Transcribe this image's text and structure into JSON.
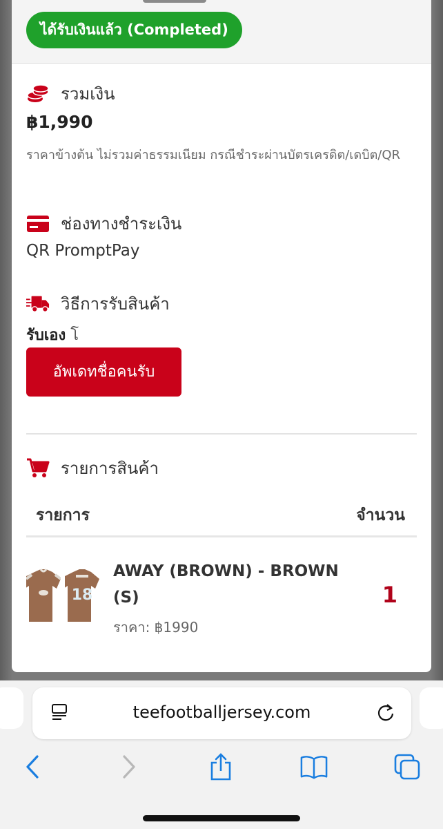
{
  "status": {
    "label": "ได้รับเงินแล้ว (Completed)",
    "color": "#1fa12b"
  },
  "total": {
    "title": "รวมเงิน",
    "icon": "coins-icon",
    "amount": "฿1,990",
    "note": "ราคาข้างต้น ไม่รวมค่าธรรมเนียม กรณีชำระผ่านบัตรเครดิต/เดบิต/QR"
  },
  "payment": {
    "title": "ช่องทางชำระเงิน",
    "icon": "credit-card-icon",
    "value": "QR PromptPay"
  },
  "shipping": {
    "title": "วิธีการรับสินค้า",
    "icon": "delivery-truck-icon",
    "method": "รับเอง",
    "method_extra": "โ",
    "update_button": "อัพเดทชื่อคนรับ"
  },
  "items": {
    "title": "รายการสินค้า",
    "icon": "shopping-cart-icon",
    "col_item": "รายการ",
    "col_qty": "จำนวน",
    "rows": [
      {
        "name": "AWAY (BROWN) - BROWN (S)",
        "price": "ราคา: ฿1990",
        "qty": "1"
      }
    ]
  },
  "browser": {
    "url": "teefootballjersey.com"
  },
  "colors": {
    "accent": "#c9021a",
    "success": "#1fa12b",
    "link": "#1a7ee0"
  }
}
